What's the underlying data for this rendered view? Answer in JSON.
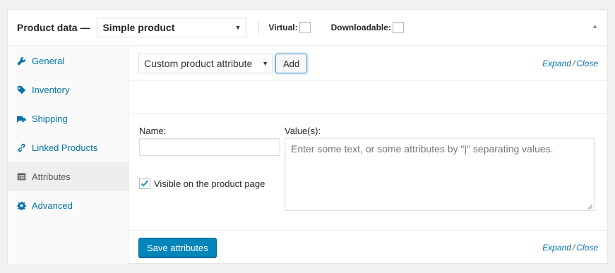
{
  "header": {
    "title": "Product data —",
    "product_type": "Simple product",
    "virtual_label": "Virtual:",
    "downloadable_label": "Downloadable:"
  },
  "tabs": [
    {
      "label": "General",
      "icon": "wrench-icon"
    },
    {
      "label": "Inventory",
      "icon": "tag-icon"
    },
    {
      "label": "Shipping",
      "icon": "truck-icon"
    },
    {
      "label": "Linked Products",
      "icon": "link-icon"
    },
    {
      "label": "Attributes",
      "icon": "list-icon",
      "active": true
    },
    {
      "label": "Advanced",
      "icon": "gear-icon"
    }
  ],
  "attributes": {
    "type_select": "Custom product attribute",
    "add_label": "Add",
    "expand_label": "Expand",
    "close_label": "Close",
    "slash": "/",
    "name_label": "Name:",
    "values_label": "Value(s):",
    "name_value": "",
    "values_placeholder": "Enter some text, or some attributes by \"|\" separating values.",
    "visible_label": "Visible on the product page",
    "save_label": "Save attributes"
  },
  "colors": {
    "link": "#0073aa",
    "primary_button": "#0085ba"
  }
}
